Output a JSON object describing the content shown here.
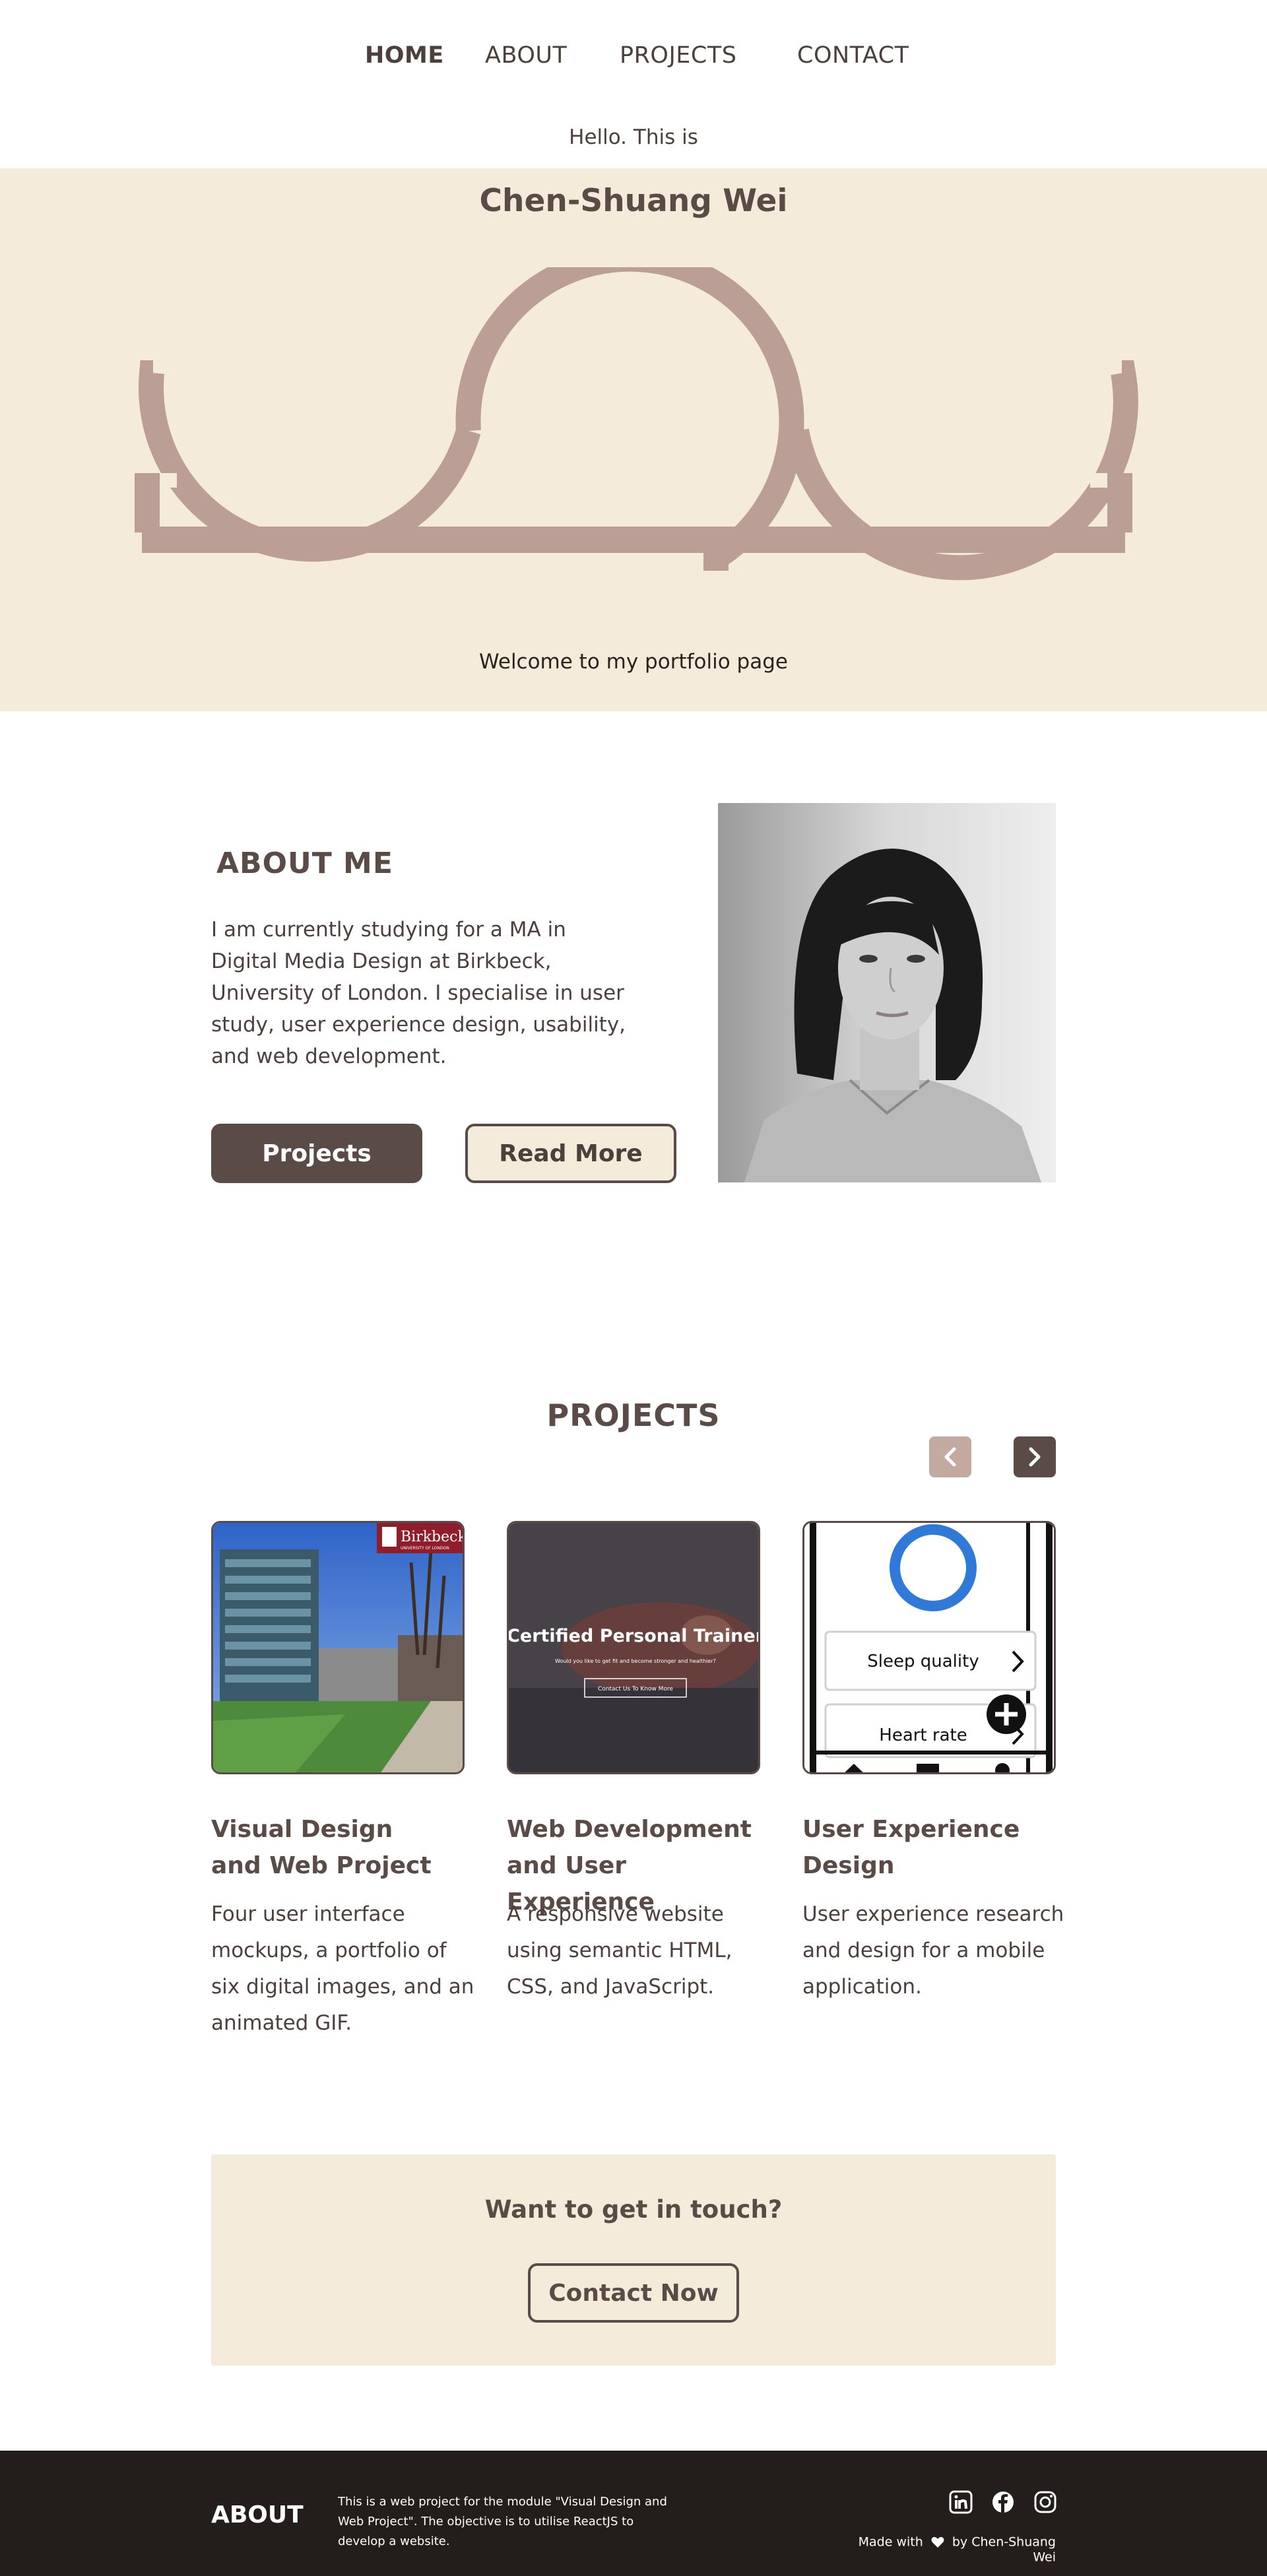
{
  "nav": {
    "home": "HOME",
    "about": "ABOUT",
    "projects": "PROJECTS",
    "contact": "CONTACT"
  },
  "hero": {
    "hello": "Hello. This is",
    "name": "Chen-Shuang Wei",
    "welcome": "Welcome to my portfolio page",
    "logo_icon": "csw-monogram-logo"
  },
  "about": {
    "title": "ABOUT ME",
    "text": "I am currently studying for a MA in Digital Media Design at Birkbeck, University of London. I specialise in user study, user experience design, usability, and web development.",
    "btn_projects": "Projects",
    "btn_read_more": "Read More"
  },
  "projects": {
    "title": "PROJECTS",
    "cards": [
      {
        "title_line1": "Visual Design",
        "title_line2": "and Web Project",
        "desc": "Four user interface mockups, a portfolio of six digital images, and an animated GIF.",
        "img_brand": "Birkbeck",
        "img_sub": "UNIVERSITY OF LONDON"
      },
      {
        "title_line1": "Web Development",
        "title_line2": "and User Experience",
        "desc": "A responsive website using semantic HTML, CSS, and JavaScript.",
        "img_heading": "Certified Personal Trainer",
        "img_sub": "Would you like to get fit and become stronger and healthier?",
        "img_button": "Contact Us To Know More"
      },
      {
        "title_line1": "User Experience",
        "title_line2": "Design",
        "desc": "User experience research and design for a mobile application.",
        "img_item1": "Sleep quality",
        "img_item2": "Heart rate"
      }
    ]
  },
  "contact": {
    "question": "Want to get in touch?",
    "button": "Contact Now"
  },
  "footer": {
    "title": "ABOUT",
    "text": "This is a web project for the module \"Visual Design and Web Project\". The objective is to utilise ReactJS to develop a website.",
    "made_prefix": "Made with",
    "made_suffix": "by Chen-Shuang Wei",
    "social_icons": [
      "linkedin-icon",
      "facebook-icon",
      "instagram-icon"
    ]
  },
  "colors": {
    "brand_dark": "#5b4b47",
    "cream": "#f5ebdb",
    "logo": "#bb9f97",
    "arrow_disabled": "#c4a9a1",
    "footer_bg": "#231e1c"
  }
}
